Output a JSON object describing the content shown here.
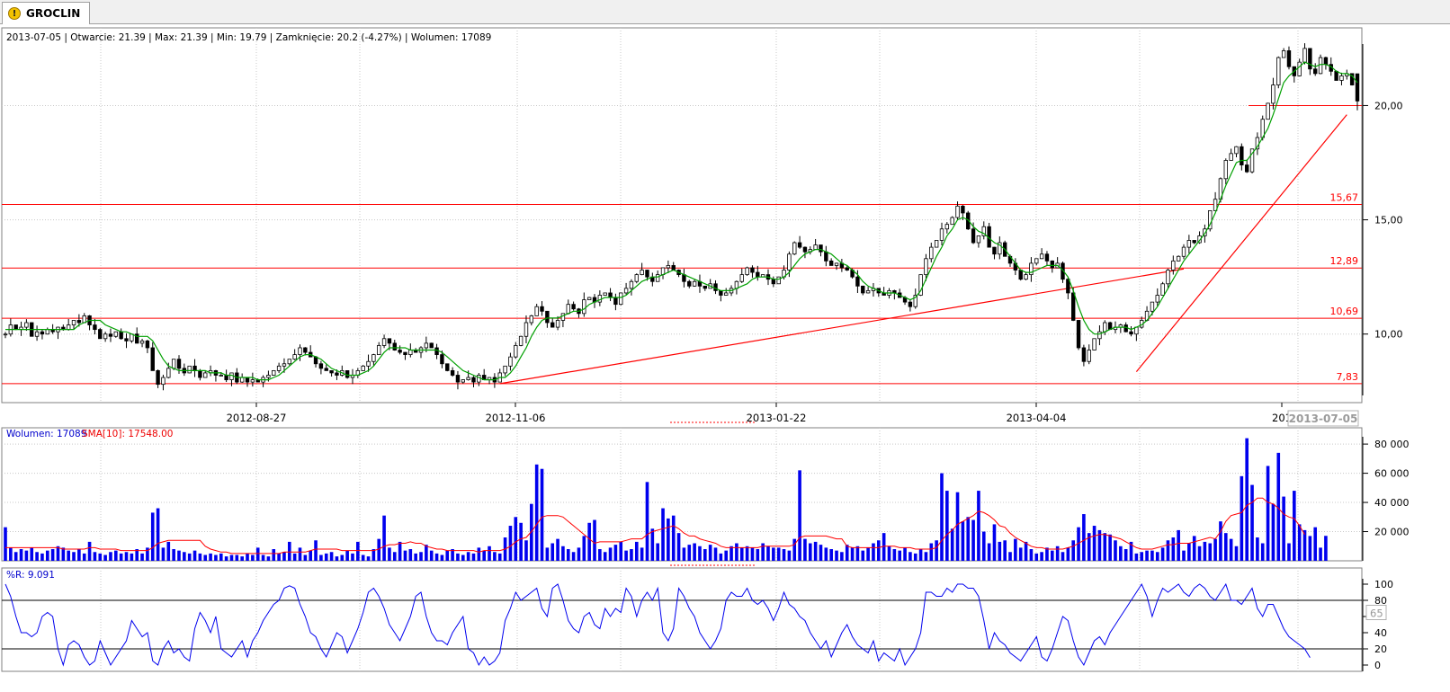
{
  "tab": {
    "label": "GROCLIN",
    "icon": "warning-icon"
  },
  "chart_data": [
    {
      "type": "candlestick",
      "info_line": "2013-07-05 | Otwarcie: 21.39 | Max: 21.39 | Min: 19.79 | Zamknięcie: 20.2 (-4.27%)  | Wolumen: 17089",
      "x_tick_labels": [
        "2012-08-27",
        "2012-11-06",
        "2013-01-22",
        "2013-04-04",
        "201"
      ],
      "cursor_date_label": "2013-07-05",
      "y_ticks": [
        10,
        15,
        20
      ],
      "y_tick_labels": [
        "10,00",
        "15,00",
        "20,00"
      ],
      "ylim": [
        7.0,
        23.4
      ],
      "horizontal_lines": [
        {
          "value": 7.83,
          "label": "7,83"
        },
        {
          "value": 10.69,
          "label": "10,69"
        },
        {
          "value": 12.89,
          "label": "12,89"
        },
        {
          "value": 15.67,
          "label": "15,67"
        }
      ],
      "close": [
        10.0,
        10.4,
        10.2,
        10.3,
        10.5,
        9.9,
        10.1,
        10.0,
        10.2,
        10.1,
        10.3,
        10.2,
        10.4,
        10.6,
        10.5,
        10.8,
        10.4,
        10.2,
        9.8,
        10.0,
        9.9,
        10.1,
        9.8,
        9.7,
        10.0,
        9.6,
        9.7,
        9.4,
        8.4,
        7.8,
        8.1,
        8.5,
        8.9,
        8.5,
        8.3,
        8.6,
        8.4,
        8.1,
        8.3,
        8.4,
        8.2,
        8.2,
        8.0,
        8.3,
        7.9,
        8.1,
        7.9,
        8.0,
        7.9,
        8.1,
        8.2,
        8.4,
        8.6,
        8.7,
        8.9,
        9.1,
        9.4,
        9.2,
        9.0,
        8.7,
        8.5,
        8.4,
        8.3,
        8.2,
        8.4,
        8.1,
        8.2,
        8.4,
        8.6,
        8.8,
        9.1,
        9.5,
        9.8,
        9.6,
        9.3,
        9.2,
        9.1,
        9.3,
        9.2,
        9.4,
        9.6,
        9.4,
        9.1,
        8.7,
        8.4,
        8.2,
        7.9,
        8.0,
        8.1,
        7.9,
        8.2,
        8.0,
        8.1,
        7.9,
        8.3,
        8.6,
        9.0,
        9.5,
        9.9,
        10.5,
        10.8,
        11.2,
        11.0,
        10.5,
        10.3,
        10.6,
        10.9,
        11.3,
        11.1,
        10.9,
        11.5,
        11.6,
        11.4,
        11.7,
        11.8,
        11.6,
        11.3,
        11.8,
        12.0,
        12.3,
        12.6,
        12.8,
        12.5,
        12.3,
        12.6,
        12.9,
        13.0,
        12.8,
        12.6,
        12.3,
        12.1,
        12.3,
        12.1,
        12.0,
        12.2,
        11.9,
        11.7,
        11.8,
        12.0,
        12.3,
        12.6,
        12.9,
        12.7,
        12.5,
        12.6,
        12.4,
        12.2,
        12.5,
        12.8,
        13.5,
        14.0,
        13.8,
        13.6,
        13.7,
        13.9,
        13.6,
        13.2,
        13.0,
        13.1,
        12.9,
        12.8,
        12.5,
        12.1,
        11.8,
        11.9,
        12.0,
        11.8,
        11.7,
        11.9,
        11.8,
        11.6,
        11.4,
        11.2,
        11.7,
        12.6,
        13.3,
        13.8,
        14.1,
        14.6,
        14.8,
        15.1,
        15.6,
        15.3,
        14.6,
        14.0,
        14.3,
        14.7,
        13.8,
        13.5,
        14.0,
        13.4,
        13.1,
        12.8,
        12.4,
        12.6,
        13.1,
        13.3,
        13.5,
        13.2,
        12.9,
        13.1,
        12.4,
        11.8,
        10.6,
        9.4,
        8.8,
        9.3,
        9.8,
        10.1,
        10.5,
        10.2,
        10.3,
        10.4,
        10.1,
        10.0,
        10.3,
        10.6,
        11.0,
        11.4,
        11.7,
        12.2,
        12.8,
        13.2,
        13.4,
        13.8,
        14.1,
        14.0,
        14.3,
        14.6,
        15.4,
        15.9,
        16.8,
        17.6,
        17.9,
        18.2,
        17.4,
        17.1,
        18.1,
        18.6,
        19.4,
        20.1,
        20.9,
        22.1,
        22.4,
        21.7,
        21.3,
        21.9,
        22.5,
        21.6,
        21.4,
        22.1,
        21.8,
        21.5,
        21.1,
        21.3,
        21.4,
        20.9,
        20.2
      ],
      "sma_close": [
        10.2,
        10.2,
        10.2,
        10.2,
        10.2,
        10.2,
        10.2,
        10.2,
        10.2,
        10.2,
        10.2,
        10.2,
        10.2,
        10.2,
        10.4,
        10.5,
        10.6,
        10.6,
        10.6,
        10.4,
        10.3,
        10.2,
        10.1,
        10.1,
        10.0,
        9.9,
        9.9,
        9.9,
        9.7,
        9.3,
        8.9,
        8.6,
        8.5,
        8.4,
        8.4,
        8.4,
        8.4,
        8.4,
        8.4,
        8.3,
        8.3,
        8.3,
        8.2,
        8.2,
        8.1,
        8.1,
        8.1,
        8.1,
        8.0,
        8.0,
        8.0,
        8.1,
        8.2,
        8.4,
        8.6,
        8.8,
        9.0,
        9.1,
        9.1,
        9.0,
        8.9,
        8.7,
        8.5,
        8.4,
        8.3,
        8.2,
        8.2,
        8.2,
        8.3,
        8.4,
        8.6,
        8.9,
        9.2,
        9.4,
        9.4,
        9.4,
        9.4,
        9.3,
        9.3,
        9.3,
        9.3,
        9.3,
        9.3,
        9.2,
        9.0,
        8.8,
        8.6,
        8.4,
        8.3,
        8.2,
        8.1,
        8.0,
        8.0,
        8.0,
        8.1,
        8.1,
        8.3,
        8.6,
        9.0,
        9.4,
        9.9,
        10.3,
        10.6,
        10.7,
        10.7,
        10.7,
        10.8,
        10.9,
        11.0,
        11.0,
        11.1,
        11.3,
        11.4,
        11.5,
        11.6,
        11.6,
        11.6,
        11.6,
        11.7,
        11.9,
        12.1,
        12.3,
        12.4,
        12.5,
        12.5,
        12.6,
        12.7,
        12.8,
        12.7,
        12.6,
        12.5,
        12.4,
        12.3,
        12.2,
        12.1,
        12.0,
        11.9,
        11.9,
        11.9,
        12.0,
        12.1,
        12.2,
        12.4,
        12.5,
        12.5,
        12.5,
        12.4,
        12.4,
        12.5,
        12.7,
        13.0,
        13.3,
        13.5,
        13.6,
        13.7,
        13.7,
        13.6,
        13.5,
        13.3,
        13.1,
        13.0,
        12.8,
        12.6,
        12.3,
        12.1,
        12.0,
        11.9,
        11.8,
        11.8,
        11.8,
        11.7,
        11.6,
        11.5,
        11.6,
        11.9,
        12.4,
        12.9,
        13.4,
        13.8,
        14.3,
        14.6,
        15.0,
        15.1,
        15.0,
        14.7,
        14.5,
        14.4,
        14.2,
        14.0,
        13.9,
        13.7,
        13.4,
        13.1,
        12.8,
        12.7,
        12.7,
        12.8,
        12.9,
        13.0,
        13.0,
        13.0,
        12.8,
        12.5,
        11.9,
        11.2,
        10.6,
        10.2,
        10.0,
        10.0,
        10.1,
        10.2,
        10.3,
        10.3,
        10.3,
        10.2,
        10.3,
        10.4,
        10.6,
        10.9,
        11.2,
        11.6,
        12.0,
        12.4,
        12.8,
        13.2,
        13.5,
        13.8,
        14.1,
        14.4,
        14.8,
        15.3,
        15.9,
        16.5,
        17.0,
        17.5,
        17.6,
        17.6,
        17.9,
        18.2,
        18.6,
        19.0,
        19.6,
        20.3,
        21.0,
        21.3,
        21.5,
        21.7,
        21.9,
        21.8,
        21.7,
        21.8,
        21.8,
        21.7,
        21.5,
        21.4,
        21.4,
        21.3,
        21.0
      ]
    },
    {
      "type": "bar",
      "legend": {
        "volume_label": "Wolumen: 17089",
        "sma_label": "SMA[10]: 17548.00"
      },
      "y_ticks": [
        20000,
        40000,
        60000,
        80000
      ],
      "y_tick_labels": [
        "20 000",
        "40 000",
        "60 000",
        "80 000"
      ],
      "ylim": [
        0,
        85000
      ],
      "volume": [
        23000,
        9000,
        6000,
        8000,
        7000,
        9000,
        6000,
        5000,
        7000,
        8000,
        10000,
        9000,
        7000,
        6000,
        8000,
        5000,
        13000,
        6000,
        5000,
        4000,
        6000,
        7000,
        5000,
        6000,
        5000,
        8000,
        5000,
        9000,
        33000,
        36000,
        9000,
        13000,
        8000,
        7000,
        6000,
        5000,
        7000,
        5000,
        4000,
        5000,
        4000,
        5000,
        3000,
        4000,
        4000,
        3000,
        5000,
        4000,
        9000,
        4000,
        3000,
        8000,
        5000,
        6000,
        13000,
        5000,
        9000,
        4000,
        7000,
        14000,
        4000,
        5000,
        6000,
        3000,
        4000,
        7000,
        5000,
        13000,
        4000,
        3000,
        8000,
        15000,
        31000,
        9000,
        6000,
        13000,
        7000,
        8000,
        5000,
        6000,
        11000,
        7000,
        5000,
        4000,
        7000,
        8000,
        5000,
        4000,
        6000,
        5000,
        9000,
        7000,
        10000,
        6000,
        5000,
        16000,
        24000,
        30000,
        26000,
        14000,
        39000,
        66000,
        63000,
        9000,
        12000,
        15000,
        10000,
        8000,
        6000,
        9000,
        17000,
        26000,
        28000,
        8000,
        6000,
        9000,
        11000,
        13000,
        7000,
        8000,
        13000,
        9000,
        54000,
        22000,
        12000,
        36000,
        29000,
        31000,
        19000,
        9000,
        11000,
        12000,
        10000,
        8000,
        11000,
        9000,
        5000,
        7000,
        10000,
        12000,
        9000,
        10000,
        9000,
        8000,
        12000,
        10000,
        9000,
        9000,
        8000,
        7000,
        15000,
        62000,
        15000,
        12000,
        13000,
        11000,
        9000,
        8000,
        7000,
        6000,
        11000,
        9000,
        10000,
        7000,
        9000,
        12000,
        14000,
        19000,
        10000,
        8000,
        7000,
        9000,
        6000,
        5000,
        8000,
        6000,
        12000,
        14000,
        60000,
        48000,
        22000,
        47000,
        27000,
        30000,
        28000,
        48000,
        20000,
        12000,
        25000,
        13000,
        14000,
        6000,
        15000,
        9000,
        13000,
        8000,
        5000,
        6000,
        9000,
        7000,
        10000,
        6000,
        9000,
        14000,
        23000,
        32000,
        19000,
        24000,
        21000,
        19000,
        18000,
        14000,
        10000,
        8000,
        13000,
        5000,
        6000,
        7000,
        7000,
        6000,
        9000,
        14000,
        16000,
        21000,
        7000,
        12000,
        17000,
        10000,
        13000,
        12000,
        15000,
        27000,
        19000,
        15000,
        10000,
        58000,
        84000,
        52000,
        16000,
        12000,
        65000,
        39000,
        74000,
        44000,
        12000,
        48000,
        25000,
        21000,
        17000,
        23000,
        9000,
        17089
      ],
      "sma": [
        9000,
        9000,
        9000,
        9000,
        9000,
        9000,
        9000,
        9000,
        9000,
        9000,
        9000,
        8000,
        8000,
        8000,
        8000,
        8000,
        9000,
        9000,
        8000,
        8000,
        8000,
        8000,
        7000,
        7000,
        7000,
        7000,
        7000,
        7000,
        9000,
        12000,
        13000,
        14000,
        14000,
        14000,
        14000,
        14000,
        14000,
        14000,
        10000,
        8000,
        7000,
        6000,
        6000,
        5000,
        5000,
        5000,
        5000,
        5000,
        5000,
        5000,
        5000,
        5000,
        5000,
        6000,
        6000,
        6000,
        6000,
        6000,
        7000,
        8000,
        8000,
        8000,
        8000,
        8000,
        7000,
        7000,
        7000,
        7000,
        7000,
        7000,
        7000,
        8000,
        10000,
        11000,
        11000,
        12000,
        12000,
        13000,
        12000,
        12000,
        10000,
        9000,
        8000,
        8000,
        7000,
        7000,
        7000,
        7000,
        7000,
        7000,
        6000,
        7000,
        7000,
        7000,
        7000,
        8000,
        10000,
        13000,
        15000,
        16000,
        20000,
        25000,
        30000,
        31000,
        31000,
        31000,
        30000,
        27000,
        24000,
        21000,
        18000,
        15000,
        12000,
        13000,
        13000,
        13000,
        13000,
        13000,
        14000,
        15000,
        15000,
        15000,
        18000,
        20000,
        21000,
        22000,
        23000,
        24000,
        22000,
        19000,
        17000,
        17000,
        15000,
        14000,
        13000,
        12000,
        10000,
        9000,
        9000,
        9000,
        9000,
        9000,
        9000,
        9000,
        10000,
        10000,
        10000,
        10000,
        10000,
        10000,
        11000,
        16000,
        17000,
        17000,
        17000,
        17000,
        17000,
        16000,
        15000,
        15000,
        10000,
        9000,
        9000,
        9000,
        9000,
        9000,
        9000,
        10000,
        10000,
        10000,
        9000,
        9000,
        9000,
        8000,
        8000,
        8000,
        8000,
        9000,
        14000,
        18000,
        21000,
        25000,
        27000,
        29000,
        31000,
        34000,
        33000,
        31000,
        28000,
        24000,
        23000,
        19000,
        16000,
        14000,
        12000,
        10000,
        9000,
        9000,
        8000,
        8000,
        8000,
        8000,
        9000,
        10000,
        12000,
        14000,
        16000,
        17000,
        18000,
        18000,
        17000,
        16000,
        15000,
        13000,
        11000,
        9000,
        8000,
        8000,
        8000,
        9000,
        10000,
        11000,
        11000,
        12000,
        12000,
        12000,
        13000,
        14000,
        15000,
        16000,
        15000,
        20000,
        27000,
        31000,
        32000,
        33000,
        38000,
        40000,
        43000,
        43000,
        40000,
        39000,
        36000,
        32000,
        30000,
        29000,
        24000,
        18000
      ],
      "dotted_line": true
    },
    {
      "type": "line",
      "legend": "%R: 9.091",
      "y_ticks": [
        0,
        20,
        40,
        60,
        80,
        100
      ],
      "y_tick_labels": [
        "0",
        "20",
        "40",
        "60",
        "80",
        "100"
      ],
      "cursor_value_label": "65",
      "ylim": [
        0,
        100
      ],
      "reference_lines": [
        20,
        80
      ],
      "values": [
        100,
        85,
        60,
        40,
        40,
        35,
        40,
        60,
        65,
        60,
        20,
        0,
        25,
        30,
        25,
        10,
        0,
        5,
        30,
        15,
        0,
        10,
        20,
        30,
        55,
        45,
        35,
        40,
        5,
        0,
        20,
        30,
        15,
        20,
        10,
        5,
        45,
        65,
        55,
        40,
        60,
        20,
        15,
        10,
        20,
        30,
        10,
        30,
        40,
        55,
        65,
        75,
        80,
        95,
        98,
        95,
        75,
        60,
        40,
        35,
        20,
        10,
        25,
        40,
        35,
        15,
        30,
        45,
        65,
        90,
        95,
        85,
        70,
        50,
        40,
        30,
        45,
        60,
        85,
        90,
        60,
        40,
        30,
        30,
        25,
        40,
        50,
        60,
        20,
        15,
        0,
        10,
        0,
        5,
        15,
        55,
        70,
        90,
        80,
        85,
        90,
        95,
        70,
        60,
        95,
        100,
        80,
        55,
        45,
        40,
        60,
        65,
        50,
        45,
        70,
        60,
        70,
        65,
        95,
        85,
        60,
        80,
        90,
        80,
        95,
        40,
        30,
        45,
        95,
        85,
        70,
        60,
        40,
        30,
        20,
        30,
        45,
        80,
        90,
        85,
        85,
        95,
        80,
        75,
        80,
        70,
        55,
        70,
        90,
        75,
        70,
        60,
        55,
        40,
        30,
        20,
        30,
        10,
        25,
        40,
        50,
        35,
        25,
        20,
        15,
        30,
        5,
        15,
        10,
        5,
        20,
        0,
        10,
        20,
        40,
        90,
        90,
        85,
        85,
        95,
        90,
        100,
        100,
        95,
        95,
        85,
        55,
        20,
        40,
        30,
        25,
        15,
        10,
        5,
        15,
        25,
        35,
        10,
        5,
        20,
        40,
        60,
        55,
        30,
        10,
        0,
        15,
        30,
        35,
        25,
        40,
        50,
        60,
        70,
        80,
        90,
        100,
        85,
        60,
        80,
        95,
        90,
        95,
        100,
        90,
        85,
        95,
        100,
        95,
        85,
        80,
        90,
        100,
        80,
        80,
        75,
        85,
        95,
        70,
        60,
        75,
        75,
        60,
        45,
        35,
        30,
        25,
        20,
        9.091
      ]
    }
  ]
}
